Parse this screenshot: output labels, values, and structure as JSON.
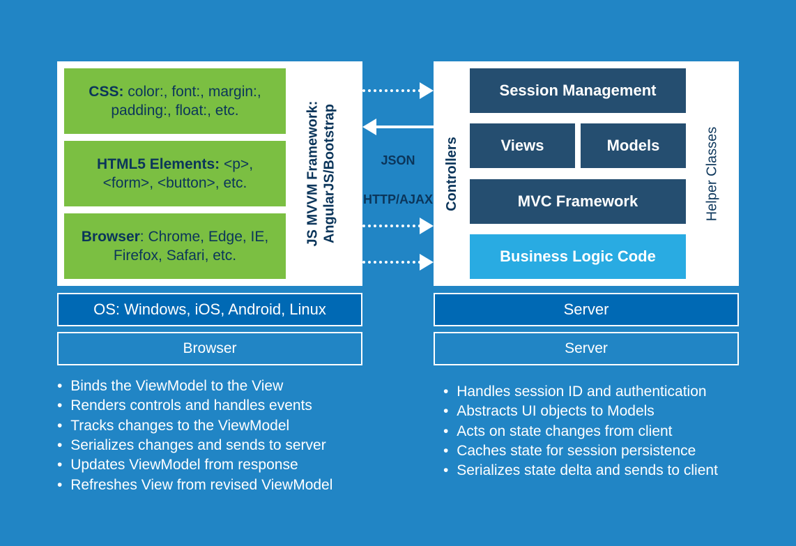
{
  "left": {
    "css": {
      "label": "CSS:",
      "text": " color:, font:, margin:, padding:, float:, etc."
    },
    "html5": {
      "label": "HTML5 Elements:",
      "text": " <p>, <form>, <button>, etc."
    },
    "browser": {
      "label": "Browser",
      "text": ": Chrome, Edge, IE, Firefox, Safari, etc."
    },
    "framework_line1": "JS MVVM Framework:",
    "framework_line2": "AngularJS/Bootstrap",
    "os": "OS: Windows, iOS, Android, Linux",
    "section_label": "Browser"
  },
  "mid": {
    "json": "JSON",
    "http": "HTTP/AJAX"
  },
  "right": {
    "controllers": "Controllers",
    "helpers": "Helper Classes",
    "session": "Session Management",
    "views": "Views",
    "models": "Models",
    "mvc": "MVC Framework",
    "business": "Business Logic Code",
    "server": "Server",
    "section_label": "Server"
  },
  "bullets_left": [
    "Binds the ViewModel to the View",
    "Renders controls and handles events",
    "Tracks changes to the ViewModel",
    "Serializes changes and sends to server",
    "Updates ViewModel from response",
    "Refreshes View from revised ViewModel"
  ],
  "bullets_right": [
    "Handles session ID and authentication",
    "Abstracts UI objects to Models",
    "Acts on state changes from client",
    "Caches state for session persistence",
    "Serializes state delta and sends to client"
  ]
}
